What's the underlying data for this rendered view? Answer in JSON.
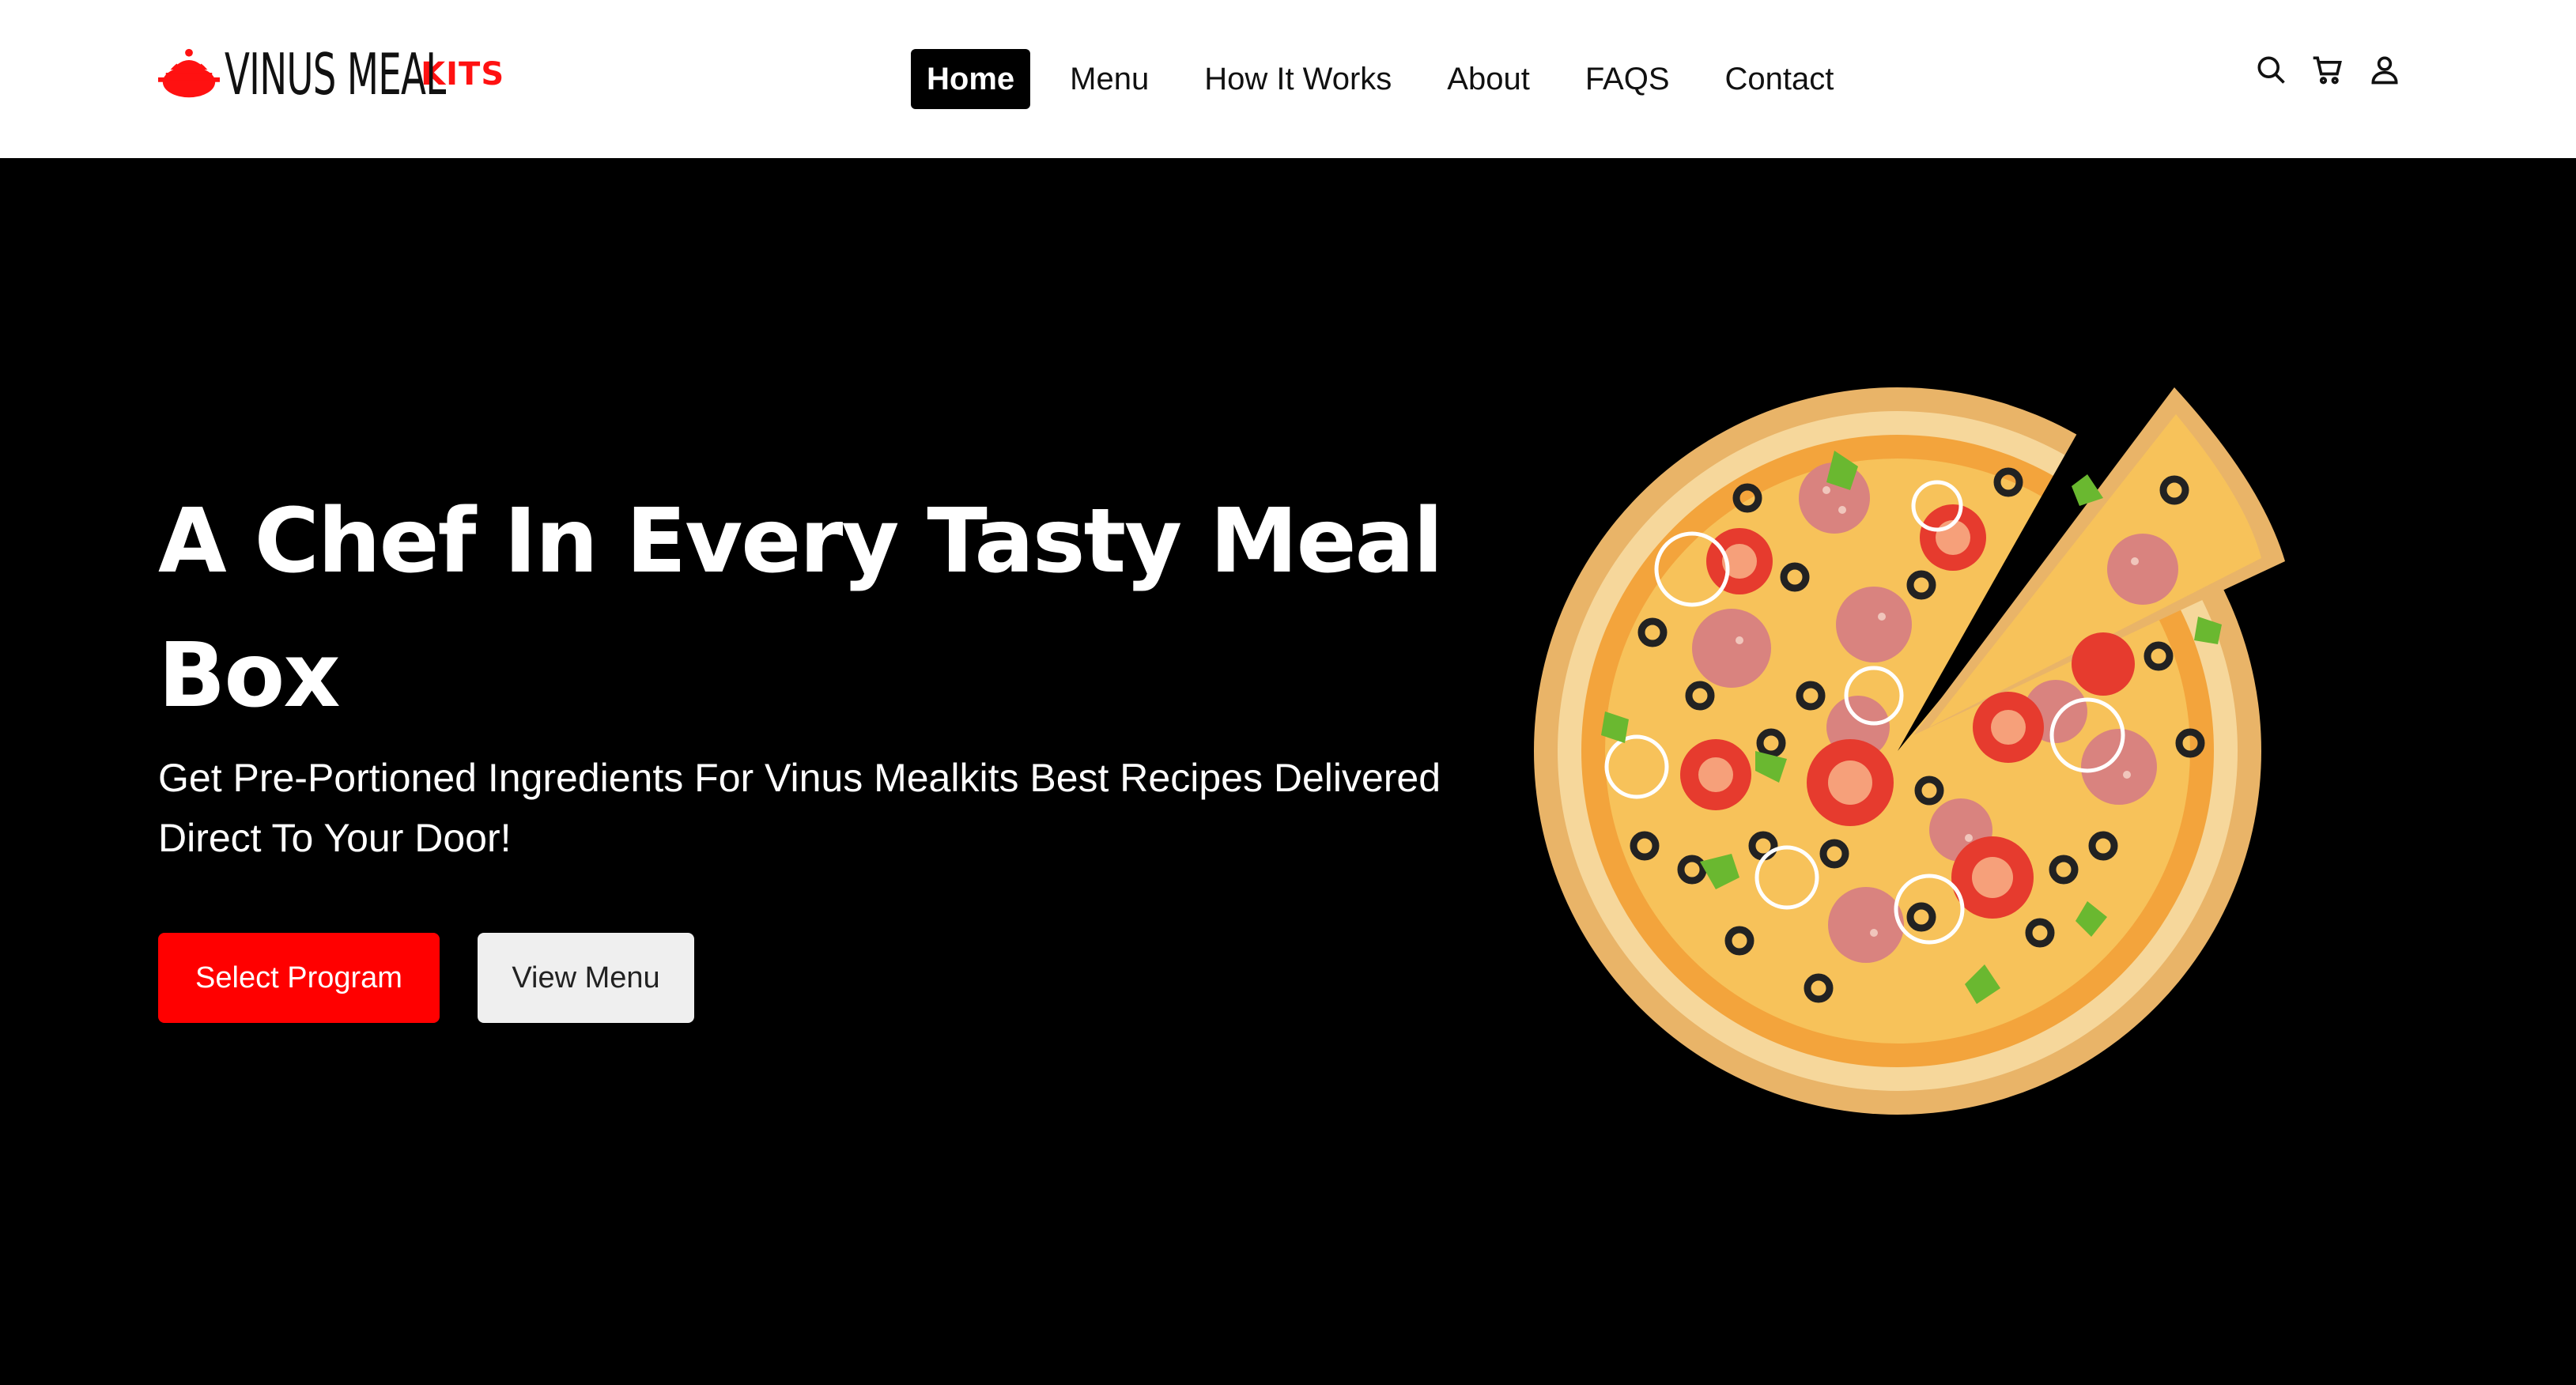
{
  "brand": {
    "name": "VINUS MEAL",
    "suffix": "KITS",
    "accent_color": "#ff0000"
  },
  "nav": {
    "items": [
      {
        "label": "Home",
        "active": true
      },
      {
        "label": "Menu"
      },
      {
        "label": "How It Works"
      },
      {
        "label": "About"
      },
      {
        "label": "FAQS"
      },
      {
        "label": "Contact"
      }
    ]
  },
  "header_icons": [
    "search-icon",
    "cart-icon",
    "user-icon"
  ],
  "hero": {
    "title": "A Chef In Every Tasty Meal Box",
    "subtitle": "Get Pre-Portioned Ingredients For Vinus Mealkits Best Recipes Delivered Direct To Your Door!",
    "primary_button": "Select Program",
    "secondary_button": "View Menu",
    "image": "pizza-illustration"
  }
}
